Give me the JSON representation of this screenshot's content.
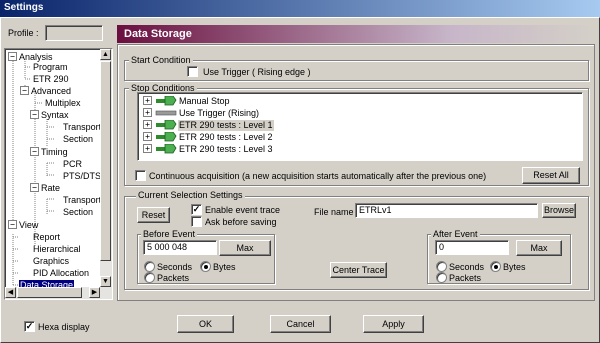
{
  "window": {
    "title": "Settings"
  },
  "profile": {
    "label": "Profile :",
    "value": ""
  },
  "header": {
    "title": "Data Storage"
  },
  "tree": {
    "items": [
      {
        "label": "Analysis"
      },
      {
        "label": "Program"
      },
      {
        "label": "ETR 290"
      },
      {
        "label": "Advanced"
      },
      {
        "label": "Multiplex"
      },
      {
        "label": "Syntax"
      },
      {
        "label": "Transport"
      },
      {
        "label": "Section"
      },
      {
        "label": "Timing"
      },
      {
        "label": "PCR"
      },
      {
        "label": "PTS/DTS"
      },
      {
        "label": "Rate"
      },
      {
        "label": "Transport"
      },
      {
        "label": "Section"
      },
      {
        "label": "View"
      },
      {
        "label": "Report"
      },
      {
        "label": "Hierarchical"
      },
      {
        "label": "Graphics"
      },
      {
        "label": "PID Allocation"
      },
      {
        "label": "Data Storage"
      }
    ]
  },
  "start_condition": {
    "title": "Start Condition",
    "use_trigger_label": "Use Trigger ( Rising edge )",
    "use_trigger_checked": false
  },
  "stop_conditions": {
    "title": "Stop Conditions",
    "items": [
      {
        "label": "Manual Stop"
      },
      {
        "label": "Use Trigger (Rising)"
      },
      {
        "label": "ETR 290 tests : Level 1"
      },
      {
        "label": "ETR 290 tests : Level 2"
      },
      {
        "label": "ETR 290 tests : Level 3"
      }
    ],
    "continuous_label": "Continuous acquisition (a new acquisition starts automatically after the previous one)",
    "continuous_checked": false,
    "reset_all_label": "Reset All"
  },
  "current_selection": {
    "title": "Current Selection Settings",
    "reset_label": "Reset",
    "enable_trace_label": "Enable event trace",
    "enable_trace_checked": true,
    "ask_saving_label": "Ask before saving",
    "ask_saving_checked": false,
    "file_name_label": "File name",
    "file_name_value": "ETRLv1",
    "browse_label": "Browse",
    "before_event": {
      "title": "Before Event",
      "value": "5 000 048",
      "max_label": "Max",
      "seconds_label": "Seconds",
      "bytes_label": "Bytes",
      "packets_label": "Packets",
      "selected_unit": "Bytes"
    },
    "center_trace_label": "Center Trace",
    "after_event": {
      "title": "After Event",
      "value": "0",
      "max_label": "Max",
      "seconds_label": "Seconds",
      "bytes_label": "Bytes",
      "packets_label": "Packets",
      "selected_unit": "Bytes"
    }
  },
  "footer": {
    "hexa_label": "Hexa display",
    "hexa_checked": true,
    "ok_label": "OK",
    "cancel_label": "Cancel",
    "apply_label": "Apply"
  },
  "colors": {
    "title_bar": "#0a246a",
    "header_accent": "#6a0f3f",
    "selection": "#000080",
    "icon_green": "#2e8b2e"
  }
}
